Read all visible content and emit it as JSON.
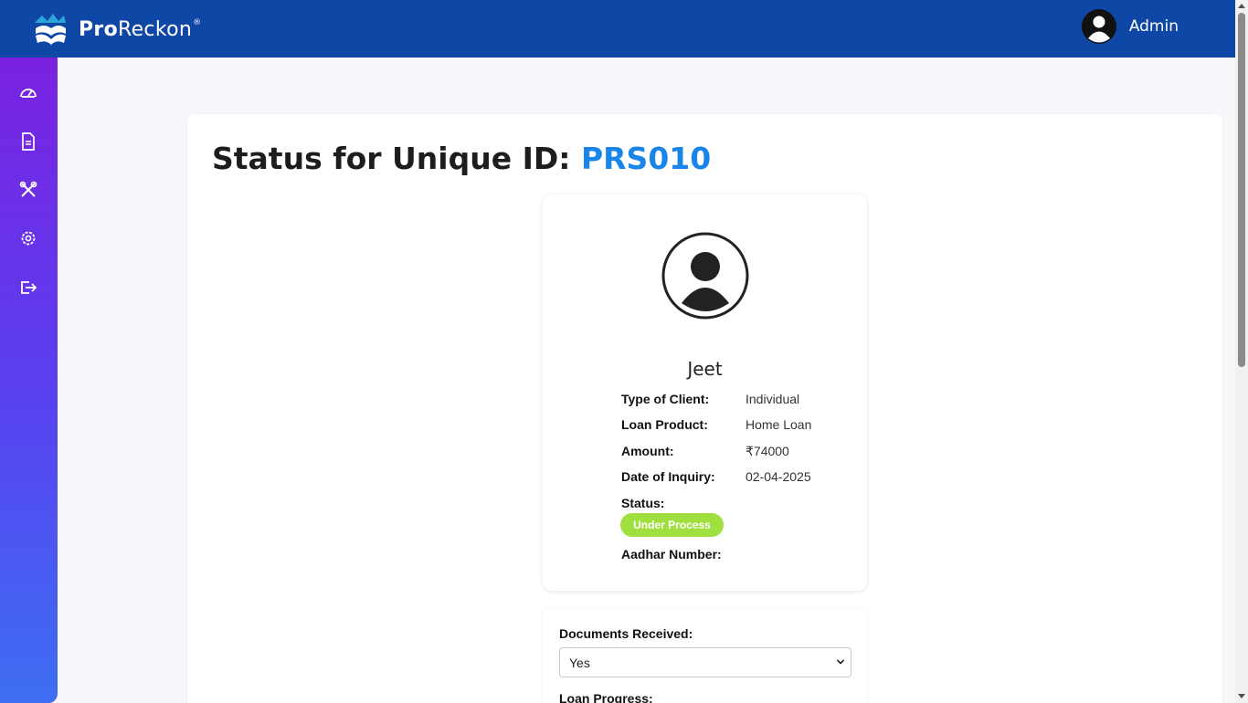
{
  "header": {
    "brand_bold": "Pro",
    "brand_light": "Reckon",
    "brand_mark": "®",
    "user_name": "Admin"
  },
  "sidebar": {
    "items": [
      {
        "icon": "dashboard-icon"
      },
      {
        "icon": "document-icon"
      },
      {
        "icon": "tools-icon"
      },
      {
        "icon": "settings-icon"
      },
      {
        "icon": "logout-icon"
      }
    ]
  },
  "page": {
    "title_prefix": "Status for Unique ID: ",
    "unique_id": "PRS010"
  },
  "profile": {
    "name": "Jeet",
    "fields": [
      {
        "label": "Type of Client:",
        "value": "Individual"
      },
      {
        "label": "Loan Product:",
        "value": "Home Loan"
      },
      {
        "label": "Amount:",
        "value": "₹74000"
      },
      {
        "label": "Date of Inquiry:",
        "value": "02-04-2025"
      }
    ],
    "status_label": "Status:",
    "status_value": "Under Process",
    "aadhar_label": "Aadhar Number:"
  },
  "form": {
    "documents_label": "Documents Received:",
    "documents_value": "Yes",
    "loan_progress_label": "Loan Progress:"
  },
  "colors": {
    "header": "#0f47a6",
    "accent_id": "#1a85e8",
    "status_pill": "#9fe03f",
    "sidebar_top": "#7a22e0",
    "sidebar_bottom": "#3d6ef2"
  }
}
